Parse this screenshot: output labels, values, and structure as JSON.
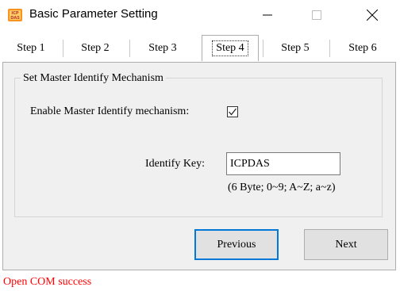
{
  "window": {
    "title": "Basic Parameter Setting",
    "icon": "icpdas-app-icon",
    "controls": [
      "minimize-icon",
      "maximize-icon",
      "close-icon"
    ]
  },
  "tabs": [
    {
      "label": "Step 1",
      "active": false
    },
    {
      "label": "Step 2",
      "active": false
    },
    {
      "label": "Step 3",
      "active": false
    },
    {
      "label": "Step 4",
      "active": true
    },
    {
      "label": "Step 5",
      "active": false
    },
    {
      "label": "Step 6",
      "active": false
    }
  ],
  "group": {
    "title": "Set Master Identify Mechanism",
    "enable_label": "Enable Master Identify mechanism:",
    "enable_checked": true,
    "key_label": "Identify Key:",
    "key_value": "ICPDAS",
    "key_hint": "(6 Byte; 0~9; A~Z; a~z)"
  },
  "buttons": {
    "previous": "Previous",
    "next": "Next"
  },
  "status": {
    "text": "Open COM success",
    "color": "#ff0000"
  },
  "colors": {
    "focus_border": "#0078d7",
    "panel_bg": "#f0f0f0"
  }
}
